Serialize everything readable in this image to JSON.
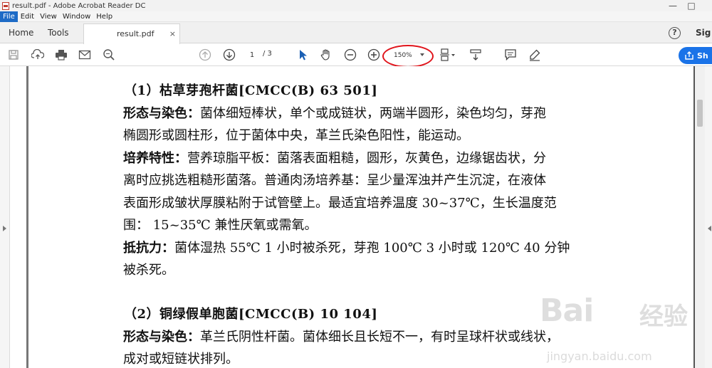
{
  "window": {
    "title": "result.pdf - Adobe Acrobat Reader DC"
  },
  "menu": [
    "File",
    "Edit",
    "View",
    "Window",
    "Help"
  ],
  "tabs": {
    "home": "Home",
    "tools": "Tools",
    "document": "result.pdf",
    "close": "×",
    "help": "?",
    "sign": "Sig"
  },
  "toolbar": {
    "page_current": "1",
    "page_total": "/ 3",
    "zoom": "150%",
    "share_label": "Sh"
  },
  "document": {
    "heading1": "（1）枯草芽孢杆菌[CMCC(B) 63 501]",
    "p1_label": "形态与染色：",
    "p1_line1": "菌体细短棒状，单个或成链状，两端半圆形，染色均匀，芽孢",
    "p1_line2": "椭圆形或圆柱形，位于菌体中央，革兰氏染色阳性，能运动。",
    "p2_label": "培养特性：",
    "p2_line1": "营养琼脂平板：菌落表面粗糙，圆形，灰黄色，边缘锯齿状，分",
    "p2_line2": "离时应挑选粗糙形菌落。普通肉汤培养基：呈少量浑浊并产生沉淀，在液体",
    "p2_line3": "表面形成皱状厚膜粘附于试管壁上。最适宜培养温度 30~37℃，生长温度范",
    "p2_line4": "围： 15~35℃ 兼性厌氧或需氧。",
    "p3_label": "抵抗力：",
    "p3_line1": "菌体湿热 55℃  1 小时被杀死，芽孢 100℃  3 小时或 120℃  40 分钟",
    "p3_line2": "被杀死。",
    "heading2": "（2）铜绿假单胞菌[CMCC(B) 10 104]",
    "p4_label": "形态与染色：",
    "p4_line1": "革兰氏阴性杆菌。菌体细长且长短不一，有时呈球杆状或线状，",
    "p4_line2": "成对或短链状排列。"
  },
  "watermark": {
    "logo": "Bai",
    "cn": "经验",
    "url": "jingyan.baidu.com"
  },
  "colors": {
    "menu_active": "#1e6bc6",
    "share_button": "#1a73e8",
    "zoom_highlight": "#e0141b",
    "select_arrow": "#1a5fb4"
  }
}
